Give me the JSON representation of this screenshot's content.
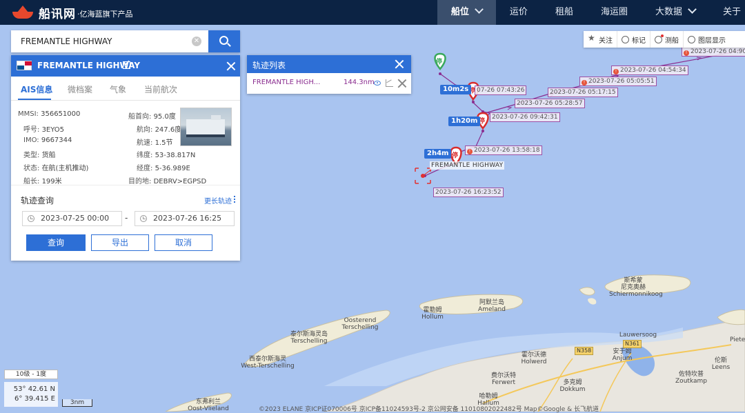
{
  "brand": {
    "name": "船讯网",
    "sub": "·亿海蓝旗下产品"
  },
  "nav": [
    {
      "label": "船位",
      "active": true,
      "dropdown": true
    },
    {
      "label": "运价",
      "active": false,
      "dropdown": false
    },
    {
      "label": "租船",
      "active": false,
      "dropdown": false
    },
    {
      "label": "海运圈",
      "active": false,
      "dropdown": false
    },
    {
      "label": "大数据",
      "active": false,
      "dropdown": true
    },
    {
      "label": "关于",
      "active": false,
      "dropdown": false
    }
  ],
  "search": {
    "value": "FREMANTLE HIGHWAY"
  },
  "ship": {
    "name": "FREMANTLE HIGHWAY",
    "tabs": [
      "AIS信息",
      "微档案",
      "气象",
      "当前航次"
    ],
    "left": [
      {
        "k": "MMSI:",
        "v": "356651000"
      },
      {
        "k": "呼号:",
        "v": "3EYO5"
      },
      {
        "k": "IMO:",
        "v": "9667344"
      },
      {
        "k": "类型:",
        "v": "货船"
      },
      {
        "k": "状态:",
        "v": "在航(主机推动)"
      },
      {
        "k": "船长:",
        "v": "199米"
      }
    ],
    "right": [
      {
        "k": "船首向:",
        "v": "95.0度"
      },
      {
        "k": "航向:",
        "v": "247.6度"
      },
      {
        "k": "航速:",
        "v": "1.5节"
      },
      {
        "k": "纬度:",
        "v": "53-38.817N"
      },
      {
        "k": "经度:",
        "v": "5-36.989E"
      },
      {
        "k": "目的地:",
        "v": "DEBRV>EGPSD"
      }
    ]
  },
  "track_query": {
    "title": "轨迹查询",
    "more": "更长轨迹",
    "start": "2023-07-25 00:00",
    "end": "2023-07-26 16:25",
    "query": "查询",
    "export": "导出",
    "cancel": "取消"
  },
  "track_list": {
    "title": "轨迹列表",
    "name": "FREMANTLE HIGH...",
    "distance": "144.3nm"
  },
  "toolbar": [
    "关注",
    "标记",
    "测船",
    "图层显示"
  ],
  "track_labels": [
    "2023-07-26 04:90",
    "2023-07-26 04:54:34",
    "2023-07-26 05:05:51",
    "2023-07-26 05:17:15",
    "2023-07-26 05:28:57",
    "2023-07-26 09:42:31",
    "07-26 07:43:26",
    "2023-07-26 13:58:18",
    "2023-07-26 16:23:52"
  ],
  "stop_badges": [
    "10m2s",
    "1h20m",
    "2h4m"
  ],
  "stop_marker": "停",
  "ship_label": "FREMANTLE HIGHWAY",
  "map_labels": {
    "schier_cn": "斯希蒙",
    "schier_cn2": "尼克奥赫",
    "schier_en": "Schiermonnikoog",
    "ameland_cn": "阿默兰岛",
    "ameland_en": "Ameland",
    "hollum_cn": "霍勒姆",
    "hollum_en": "Hollum",
    "oosterend_en": "Oosterend",
    "oost_en2": "Terschelling",
    "tersch_cn": "泰尔斯海灵岛",
    "tersch_en": "Terschelling",
    "west_cn": "西泰尔斯海灵",
    "west_en": "West-Terschelling",
    "lauwersoog": "Lauwersoog",
    "holwerd_cn": "霍尔沃德",
    "holwerd_en": "Holwerd",
    "anjum_cn": "安于姆",
    "anjum_en": "Anjum",
    "ferwert_cn": "费尔沃特",
    "ferwert_en": "Ferwert",
    "zoutkamp_cn": "佐特坎普",
    "zoutkamp_en": "Zoutkamp",
    "leens_cn": "伦斯",
    "leens_en": "Leens",
    "dokkum_cn": "多克姆",
    "dokkum_en": "Dokkum",
    "hallum_cn": "哈勒姆",
    "hallum_en": "Hallum",
    "vlieland_cn": "东弗利兰",
    "vlieland_en": "Oost-Vlieland",
    "pieter": "Pieter",
    "n361": "N361",
    "n358": "N358"
  },
  "bottom": {
    "level": "10级 - 1度",
    "lat": "53° 42.61 N",
    "lon": "6° 39.415 E",
    "scale": "3nm",
    "copyright": "©2023 ELANE  京ICP证070006号  京ICP备11024593号-2  京公网安备 11010802022482号  Map©Google & 长飞航道"
  },
  "colors": {
    "nav_bg": "#0c2344",
    "accent": "#2d6fd6",
    "track": "#8a2c8f",
    "sea": "#a9c4f0",
    "land": "#e9e6df"
  }
}
